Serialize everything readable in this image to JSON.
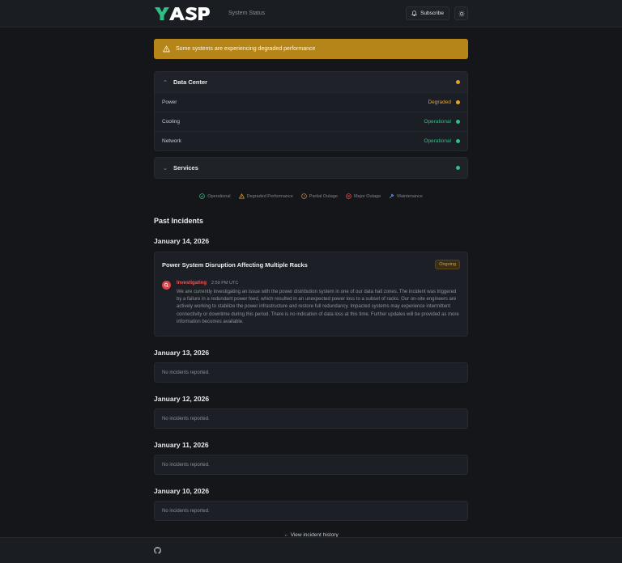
{
  "header": {
    "brand": "YASP",
    "subtitle": "System Status",
    "subscribe_label": "Subscribe",
    "theme_icon": "sun-icon",
    "bell_icon": "bell-icon"
  },
  "banner": {
    "text": "Some systems are experiencing degraded performance",
    "color": "#b6851a",
    "icon": "warning-triangle-icon"
  },
  "groups": [
    {
      "name": "Data Center",
      "expanded": true,
      "status_color": "#e3a32b",
      "components": [
        {
          "name": "Power",
          "status": "Degraded",
          "color": "#e3a32b"
        },
        {
          "name": "Cooling",
          "status": "Operational",
          "color": "#2fbf85"
        },
        {
          "name": "Network",
          "status": "Operational",
          "color": "#2fbf85"
        }
      ]
    },
    {
      "name": "Services",
      "expanded": false,
      "status_color": "#2fbf85"
    }
  ],
  "legend": [
    {
      "label": "Operational",
      "icon": "check-circle-icon",
      "color": "#2fbf85"
    },
    {
      "label": "Degraded Performance",
      "icon": "warning-triangle-icon",
      "color": "#e3a32b"
    },
    {
      "label": "Partial Outage",
      "icon": "exclamation-circle-icon",
      "color": "#e08a2b"
    },
    {
      "label": "Major Outage",
      "icon": "x-circle-icon",
      "color": "#e05252"
    },
    {
      "label": "Maintenance",
      "icon": "wrench-icon",
      "color": "#5b8de0"
    }
  ],
  "past_incidents": {
    "title": "Past Incidents",
    "days": [
      {
        "date": "January 14, 2026",
        "incidents": [
          {
            "title": "Power System Disruption Affecting Multiple Racks",
            "badge": "Ongoing",
            "updates": [
              {
                "status": "Investigating",
                "time": "2:59 PM UTC",
                "text": "We are currently investigating an issue with the power distribution system in one of our data hall zones. The incident was triggered by a failure in a redundant power feed, which resulted in an unexpected power loss to a subset of racks. Our on-site engineers are actively working to stabilize the power infrastructure and restore full redundancy. Impacted systems may experience intermittent connectivity or downtime during this period. There is no indication of data loss at this time. Further updates will be provided as more information becomes available."
              }
            ]
          }
        ]
      },
      {
        "date": "January 13, 2026",
        "empty_text": "No incidents reported."
      },
      {
        "date": "January 12, 2026",
        "empty_text": "No incidents reported."
      },
      {
        "date": "January 11, 2026",
        "empty_text": "No incidents reported."
      },
      {
        "date": "January 10, 2026",
        "empty_text": "No incidents reported."
      }
    ],
    "history_link": "← View incident history"
  },
  "footer": {
    "icon": "github-icon"
  }
}
